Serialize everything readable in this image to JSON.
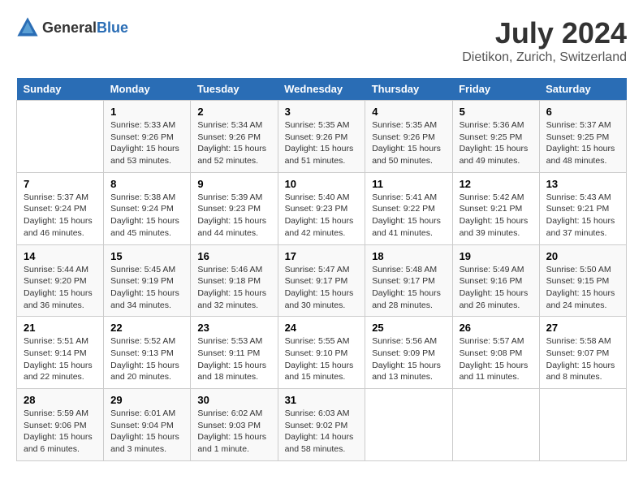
{
  "header": {
    "logo_general": "General",
    "logo_blue": "Blue",
    "title": "July 2024",
    "subtitle": "Dietikon, Zurich, Switzerland"
  },
  "calendar": {
    "days_of_week": [
      "Sunday",
      "Monday",
      "Tuesday",
      "Wednesday",
      "Thursday",
      "Friday",
      "Saturday"
    ],
    "weeks": [
      [
        {
          "day": "",
          "content": ""
        },
        {
          "day": "1",
          "content": "Sunrise: 5:33 AM\nSunset: 9:26 PM\nDaylight: 15 hours\nand 53 minutes."
        },
        {
          "day": "2",
          "content": "Sunrise: 5:34 AM\nSunset: 9:26 PM\nDaylight: 15 hours\nand 52 minutes."
        },
        {
          "day": "3",
          "content": "Sunrise: 5:35 AM\nSunset: 9:26 PM\nDaylight: 15 hours\nand 51 minutes."
        },
        {
          "day": "4",
          "content": "Sunrise: 5:35 AM\nSunset: 9:26 PM\nDaylight: 15 hours\nand 50 minutes."
        },
        {
          "day": "5",
          "content": "Sunrise: 5:36 AM\nSunset: 9:25 PM\nDaylight: 15 hours\nand 49 minutes."
        },
        {
          "day": "6",
          "content": "Sunrise: 5:37 AM\nSunset: 9:25 PM\nDaylight: 15 hours\nand 48 minutes."
        }
      ],
      [
        {
          "day": "7",
          "content": "Sunrise: 5:37 AM\nSunset: 9:24 PM\nDaylight: 15 hours\nand 46 minutes."
        },
        {
          "day": "8",
          "content": "Sunrise: 5:38 AM\nSunset: 9:24 PM\nDaylight: 15 hours\nand 45 minutes."
        },
        {
          "day": "9",
          "content": "Sunrise: 5:39 AM\nSunset: 9:23 PM\nDaylight: 15 hours\nand 44 minutes."
        },
        {
          "day": "10",
          "content": "Sunrise: 5:40 AM\nSunset: 9:23 PM\nDaylight: 15 hours\nand 42 minutes."
        },
        {
          "day": "11",
          "content": "Sunrise: 5:41 AM\nSunset: 9:22 PM\nDaylight: 15 hours\nand 41 minutes."
        },
        {
          "day": "12",
          "content": "Sunrise: 5:42 AM\nSunset: 9:21 PM\nDaylight: 15 hours\nand 39 minutes."
        },
        {
          "day": "13",
          "content": "Sunrise: 5:43 AM\nSunset: 9:21 PM\nDaylight: 15 hours\nand 37 minutes."
        }
      ],
      [
        {
          "day": "14",
          "content": "Sunrise: 5:44 AM\nSunset: 9:20 PM\nDaylight: 15 hours\nand 36 minutes."
        },
        {
          "day": "15",
          "content": "Sunrise: 5:45 AM\nSunset: 9:19 PM\nDaylight: 15 hours\nand 34 minutes."
        },
        {
          "day": "16",
          "content": "Sunrise: 5:46 AM\nSunset: 9:18 PM\nDaylight: 15 hours\nand 32 minutes."
        },
        {
          "day": "17",
          "content": "Sunrise: 5:47 AM\nSunset: 9:17 PM\nDaylight: 15 hours\nand 30 minutes."
        },
        {
          "day": "18",
          "content": "Sunrise: 5:48 AM\nSunset: 9:17 PM\nDaylight: 15 hours\nand 28 minutes."
        },
        {
          "day": "19",
          "content": "Sunrise: 5:49 AM\nSunset: 9:16 PM\nDaylight: 15 hours\nand 26 minutes."
        },
        {
          "day": "20",
          "content": "Sunrise: 5:50 AM\nSunset: 9:15 PM\nDaylight: 15 hours\nand 24 minutes."
        }
      ],
      [
        {
          "day": "21",
          "content": "Sunrise: 5:51 AM\nSunset: 9:14 PM\nDaylight: 15 hours\nand 22 minutes."
        },
        {
          "day": "22",
          "content": "Sunrise: 5:52 AM\nSunset: 9:13 PM\nDaylight: 15 hours\nand 20 minutes."
        },
        {
          "day": "23",
          "content": "Sunrise: 5:53 AM\nSunset: 9:11 PM\nDaylight: 15 hours\nand 18 minutes."
        },
        {
          "day": "24",
          "content": "Sunrise: 5:55 AM\nSunset: 9:10 PM\nDaylight: 15 hours\nand 15 minutes."
        },
        {
          "day": "25",
          "content": "Sunrise: 5:56 AM\nSunset: 9:09 PM\nDaylight: 15 hours\nand 13 minutes."
        },
        {
          "day": "26",
          "content": "Sunrise: 5:57 AM\nSunset: 9:08 PM\nDaylight: 15 hours\nand 11 minutes."
        },
        {
          "day": "27",
          "content": "Sunrise: 5:58 AM\nSunset: 9:07 PM\nDaylight: 15 hours\nand 8 minutes."
        }
      ],
      [
        {
          "day": "28",
          "content": "Sunrise: 5:59 AM\nSunset: 9:06 PM\nDaylight: 15 hours\nand 6 minutes."
        },
        {
          "day": "29",
          "content": "Sunrise: 6:01 AM\nSunset: 9:04 PM\nDaylight: 15 hours\nand 3 minutes."
        },
        {
          "day": "30",
          "content": "Sunrise: 6:02 AM\nSunset: 9:03 PM\nDaylight: 15 hours\nand 1 minute."
        },
        {
          "day": "31",
          "content": "Sunrise: 6:03 AM\nSunset: 9:02 PM\nDaylight: 14 hours\nand 58 minutes."
        },
        {
          "day": "",
          "content": ""
        },
        {
          "day": "",
          "content": ""
        },
        {
          "day": "",
          "content": ""
        }
      ]
    ]
  }
}
